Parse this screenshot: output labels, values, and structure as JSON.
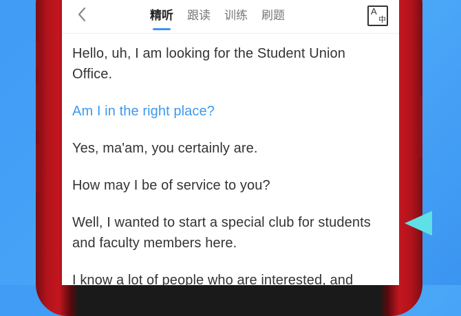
{
  "header": {
    "back_icon": "chevron-left-icon",
    "tabs": [
      {
        "label": "精听",
        "active": true
      },
      {
        "label": "跟读",
        "active": false
      },
      {
        "label": "训练",
        "active": false
      },
      {
        "label": "刷题",
        "active": false
      }
    ],
    "font_button": {
      "icon": "font-size-icon",
      "glyph_a": "A",
      "glyph_hanzi": "中"
    }
  },
  "transcript": [
    {
      "text": "Hello, uh, I am looking for the Student Union Office.",
      "highlighted": false
    },
    {
      "text": "Am I in the right place?",
      "highlighted": true
    },
    {
      "text": "Yes, ma'am, you certainly are.",
      "highlighted": false
    },
    {
      "text": "How may I be of service to you?",
      "highlighted": false
    },
    {
      "text": "Well, I wanted to start a special club for students and faculty members here.",
      "highlighted": false
    },
    {
      "text": "I know a lot of people who are interested, and",
      "highlighted": false
    }
  ],
  "colors": {
    "accent": "#3d98ee",
    "background": "#4aa6f7",
    "frame": "#c3161f",
    "play": "#5ee0e6"
  }
}
